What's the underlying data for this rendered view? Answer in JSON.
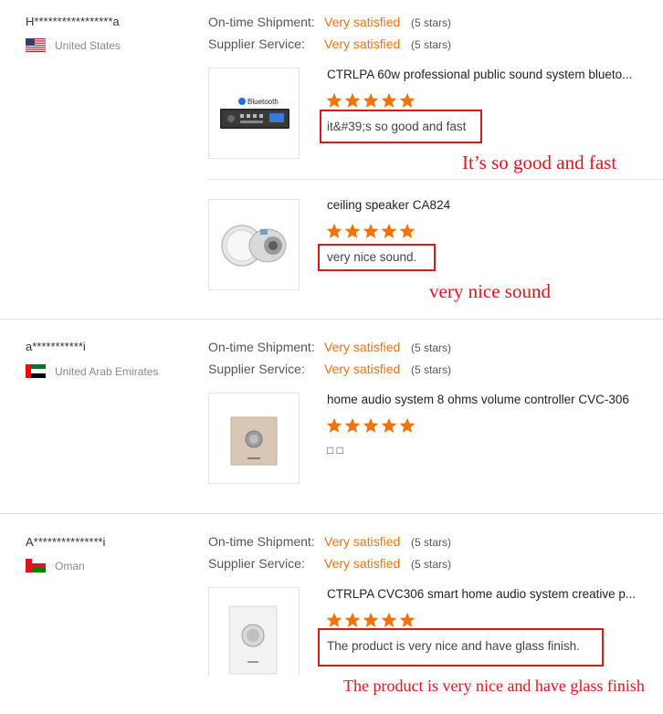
{
  "labels": {
    "ontime": "On-time Shipment:",
    "supplier": "Supplier Service:",
    "very_satisfied": "Very satisfied",
    "five_stars": "(5 stars)"
  },
  "colors": {
    "accent": "#f0730e",
    "annotation_red": "#e0141e",
    "box_red": "#d51a1a"
  },
  "reviews": [
    {
      "reviewer": "H*****************a",
      "country": "United States",
      "flag_icon": "us-flag-icon",
      "products": [
        {
          "title": "CTRLPA 60w professional public sound system blueto...",
          "thumb_text": "Bluetooth",
          "rating": 5,
          "comment": "it&#39;s so good and fast",
          "annotation": "It’s so good and fast"
        },
        {
          "title": "ceiling speaker CA824",
          "rating": 5,
          "comment": "very nice sound.",
          "annotation": "very nice sound"
        }
      ]
    },
    {
      "reviewer": "a***********i",
      "country": "United Arab Emirates",
      "flag_icon": "uae-flag-icon",
      "products": [
        {
          "title": "home audio system 8 ohms volume controller CVC-306",
          "rating": 5,
          "comment": "□ □"
        }
      ]
    },
    {
      "reviewer": "A***************i",
      "country": "Oman",
      "flag_icon": "oman-flag-icon",
      "products": [
        {
          "title": "CTRLPA CVC306 smart home audio system creative p...",
          "rating": 5,
          "comment": "The product is very nice and have glass finish.",
          "annotation": "The product is very nice and have glass finish"
        }
      ]
    }
  ]
}
